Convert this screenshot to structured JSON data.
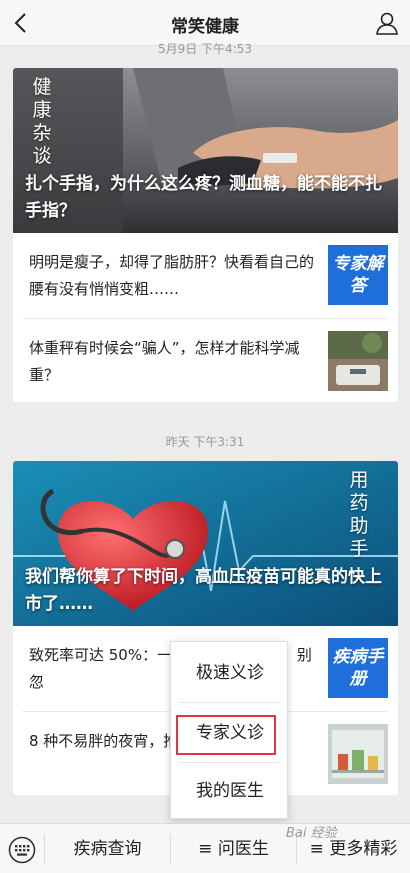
{
  "header": {
    "title": "常笑健康"
  },
  "feed": [
    {
      "timestamp": "5月9日 下午4:53",
      "tag_chars": [
        "健",
        "康",
        "杂",
        "谈"
      ],
      "headline": "扎个手指，为什么这么疼？测血糖，能不能不扎手指？",
      "items": [
        {
          "text": "明明是瘦子，却得了脂肪肝？快看看自己的腰有没有悄悄变粗……",
          "thumb_label": "专家解答",
          "thumb_color": "#1e6fd9"
        },
        {
          "text": "体重秤有时候会“骗人”，怎样才能科学减重？",
          "thumb_label": "",
          "thumb_color": "#7a6a58"
        }
      ]
    },
    {
      "timestamp": "昨天 下午3:31",
      "tag_chars": [
        "用",
        "药",
        "助",
        "手"
      ],
      "headline": "我们帮你算了下时间，高血压疫苗可能真的快上市了……",
      "items": [
        {
          "text": "致死率可达 50%：一 很可能是胰腺炎，别忽",
          "thumb_label": "疾病手册",
          "thumb_color": "#1e6fd9"
        },
        {
          "text": "8 种不易胖的夜宵，推 的你！",
          "thumb_label": "",
          "thumb_color": "#5f8d6a"
        }
      ]
    }
  ],
  "popup_menu": {
    "items": [
      "极速义诊",
      "专家义诊",
      "我的医生"
    ],
    "highlighted": "专家义诊",
    "highlight_color": "#e0373e"
  },
  "bottom_bar": {
    "tabs": [
      "疾病查询",
      "≡ 问医生",
      "≡ 更多精彩"
    ]
  },
  "watermark": "Bai 经验"
}
